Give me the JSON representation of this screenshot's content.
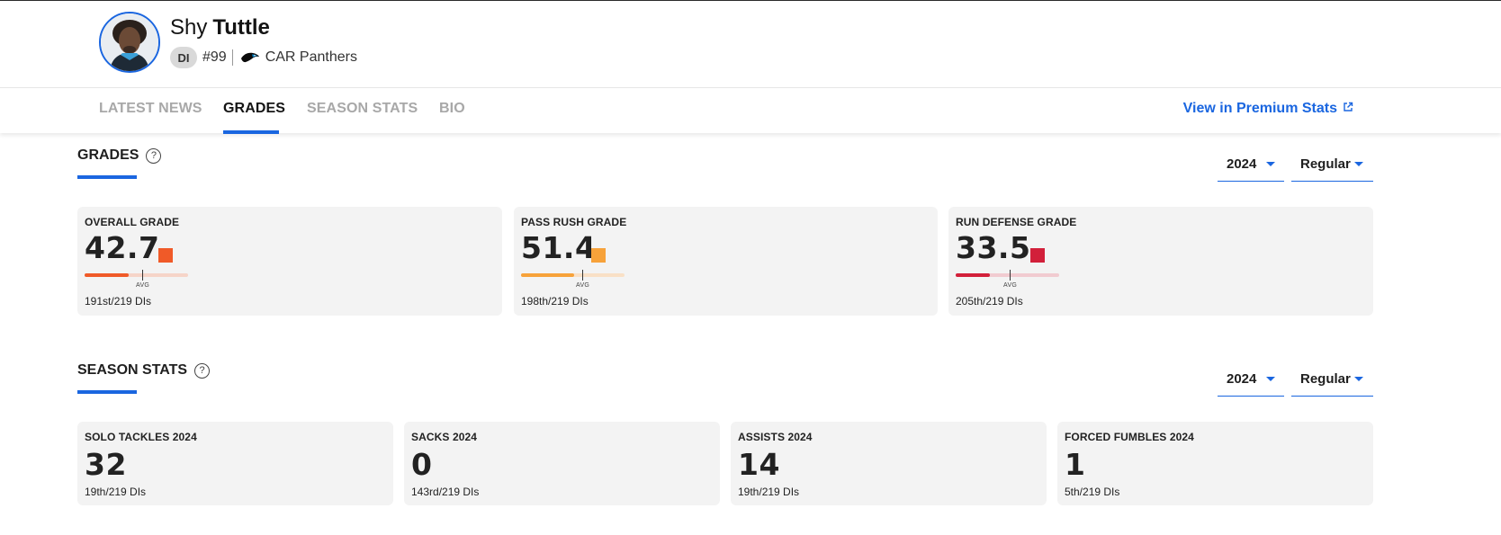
{
  "player": {
    "first_name": "Shy",
    "last_name": "Tuttle",
    "position": "DI",
    "jersey": "#99",
    "team": "CAR Panthers"
  },
  "tabs": [
    {
      "label": "LATEST NEWS",
      "active": false
    },
    {
      "label": "GRADES",
      "active": true
    },
    {
      "label": "SEASON STATS",
      "active": false
    },
    {
      "label": "BIO",
      "active": false
    }
  ],
  "premium_link": "View in Premium Stats",
  "grades": {
    "title": "GRADES",
    "help": "?",
    "year": "2024",
    "season_type": "Regular",
    "cards": [
      {
        "label": "OVERALL GRADE",
        "value": "42.7",
        "rank": "191st/219 DIs",
        "grade_pct": 0.427,
        "color": "#f05a28",
        "track": "#f6d4c8"
      },
      {
        "label": "PASS RUSH GRADE",
        "value": "51.4",
        "rank": "198th/219 DIs",
        "grade_pct": 0.514,
        "color": "#f7a23a",
        "track": "#f9e0c6"
      },
      {
        "label": "RUN DEFENSE GRADE",
        "value": "33.5",
        "rank": "205th/219 DIs",
        "grade_pct": 0.335,
        "color": "#d2203a",
        "track": "#f1cbd0"
      }
    ],
    "avg_label": "AVG"
  },
  "season_stats": {
    "title": "SEASON STATS",
    "help": "?",
    "year": "2024",
    "season_type": "Regular",
    "cards": [
      {
        "label": "SOLO TACKLES 2024",
        "value": "32",
        "rank": "19th/219 DIs"
      },
      {
        "label": "SACKS 2024",
        "value": "0",
        "rank": "143rd/219 DIs"
      },
      {
        "label": "ASSISTS 2024",
        "value": "14",
        "rank": "19th/219 DIs"
      },
      {
        "label": "FORCED FUMBLES 2024",
        "value": "1",
        "rank": "5th/219 DIs"
      }
    ]
  },
  "colors": {
    "accent": "#1a66e0",
    "card_bg": "#f3f3f3"
  },
  "icons": {
    "external_link": "external-link-icon",
    "help": "question-circle-icon",
    "dropdown": "caret-down-icon",
    "team_logo": "panthers-logo-icon"
  }
}
